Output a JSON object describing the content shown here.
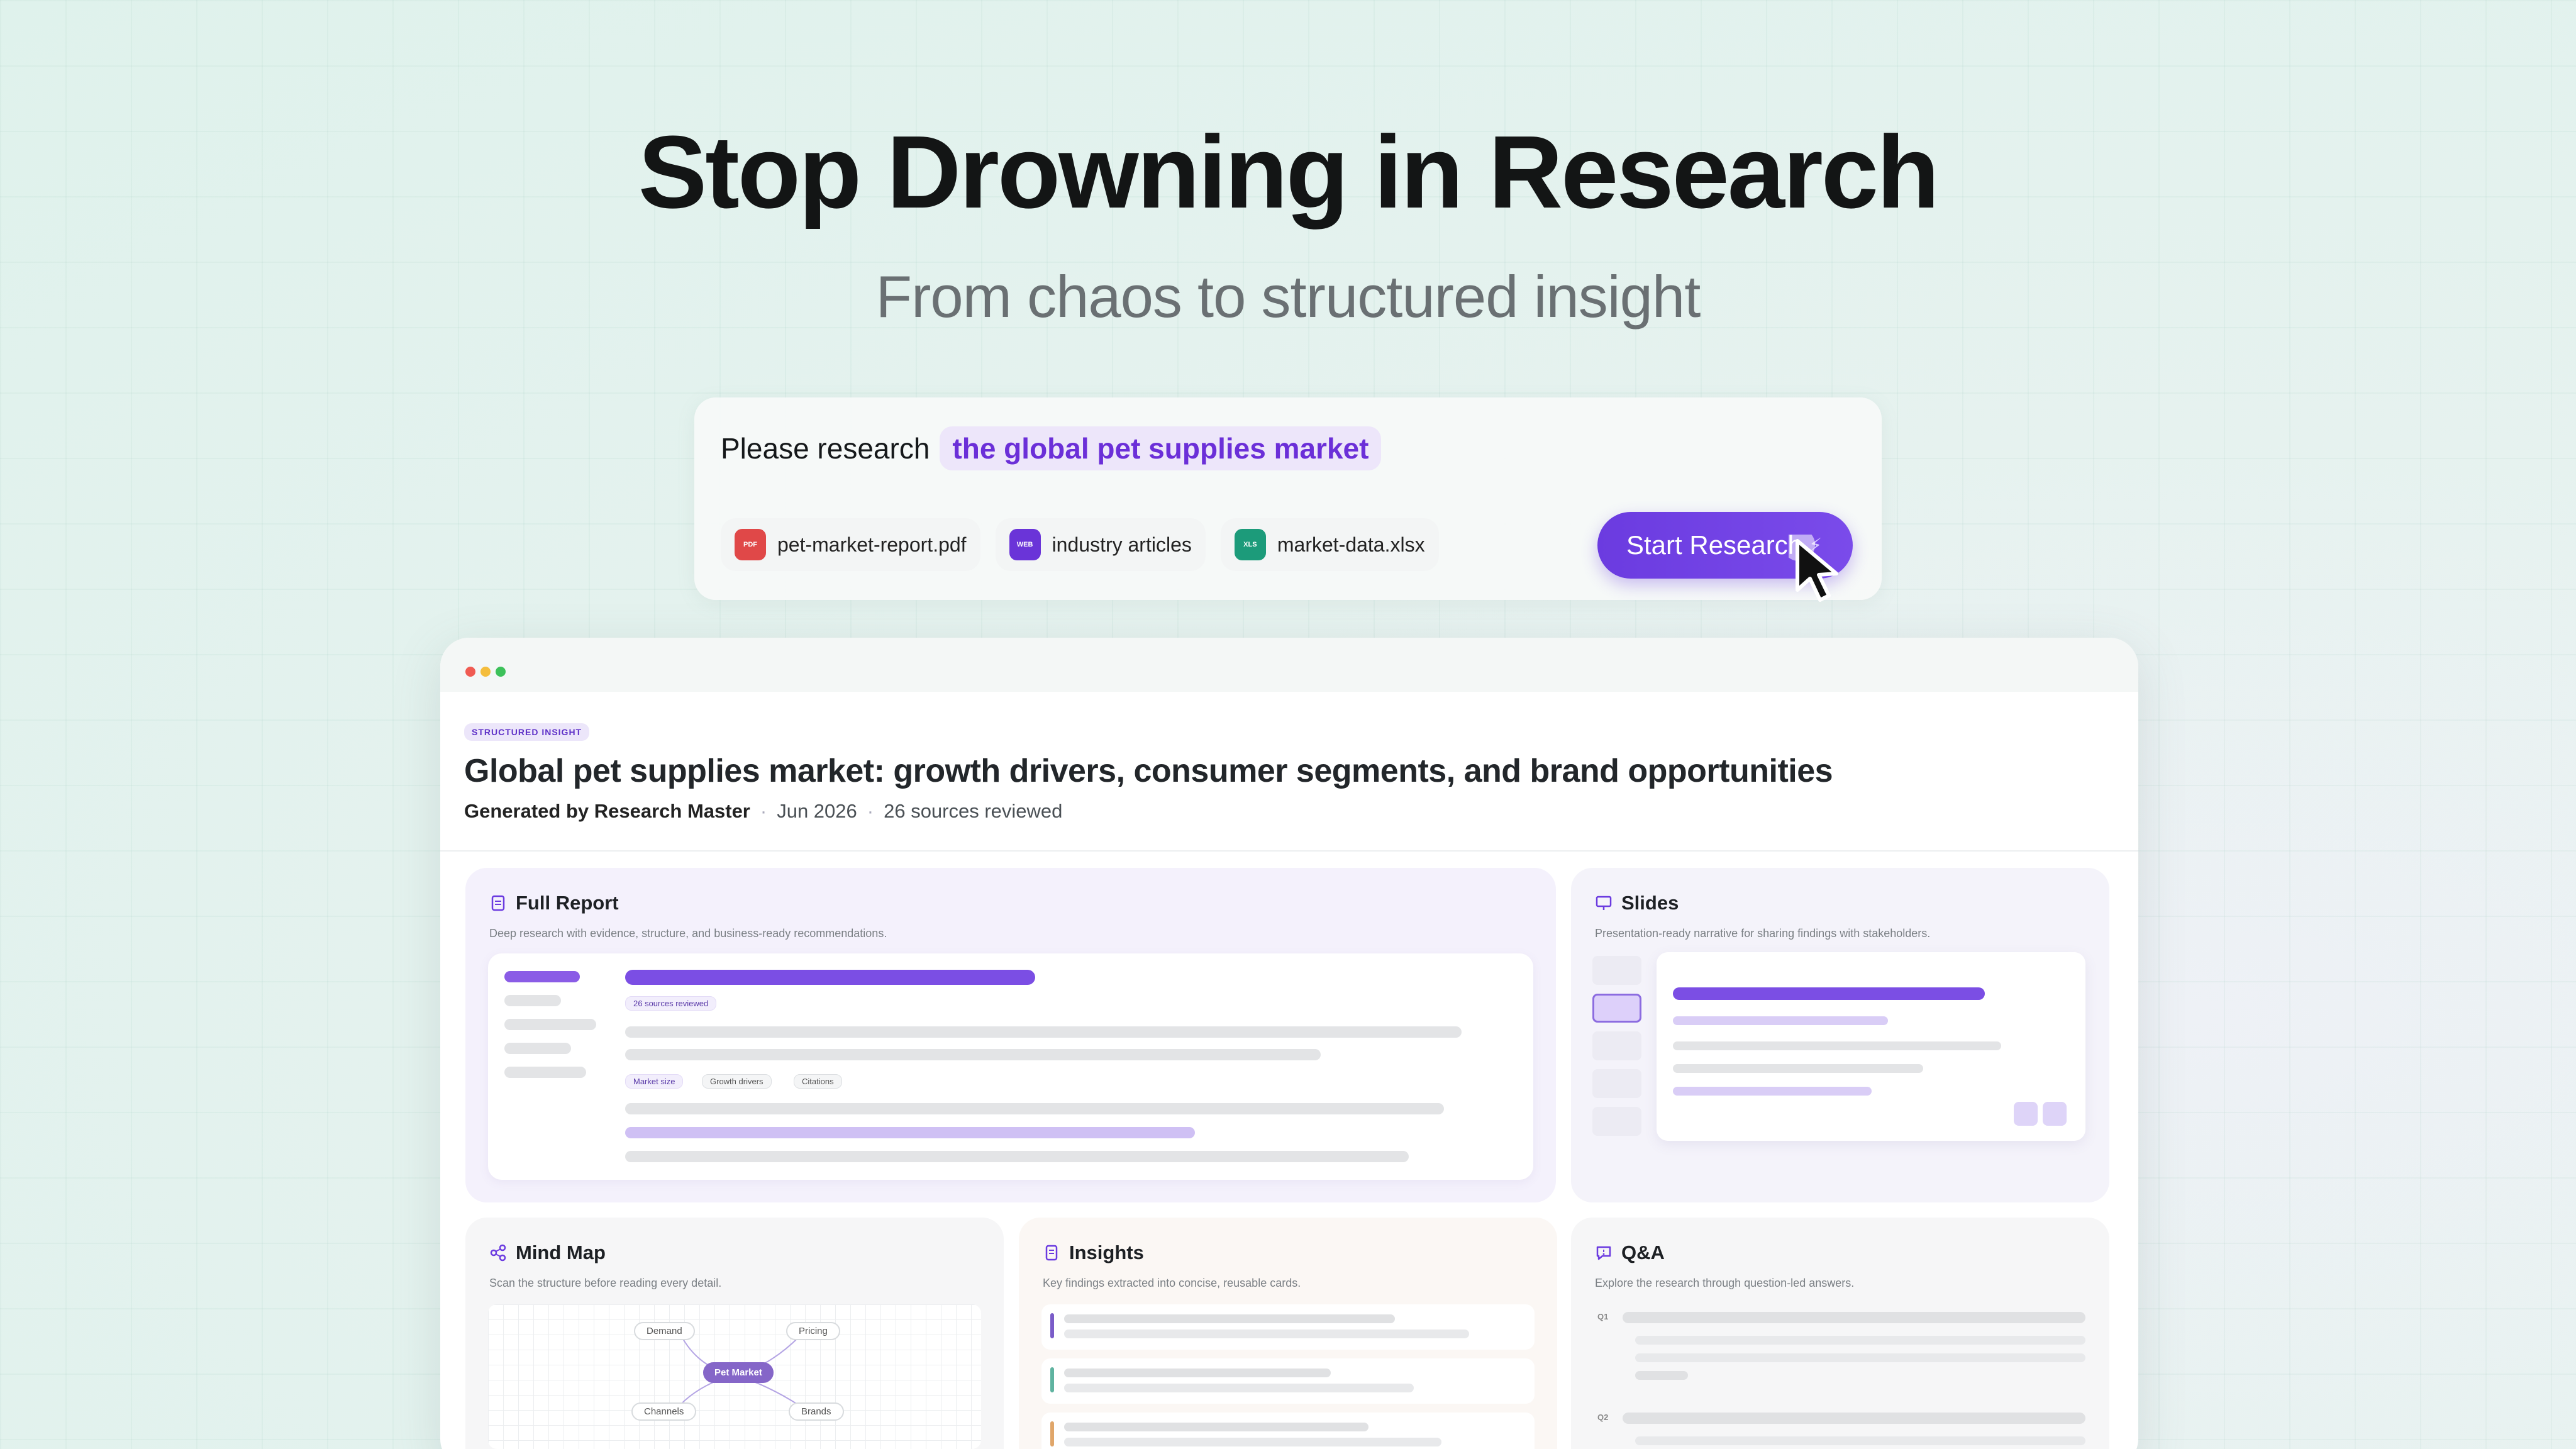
{
  "hero": {
    "title": "Stop Drowning in Research",
    "subtitle": "From chaos to structured insight"
  },
  "prompt": {
    "text": "Please research",
    "topic": "the global pet supplies market",
    "attachments": [
      {
        "badge": "PDF",
        "name": "pet-market-report.pdf",
        "color": "#e04848"
      },
      {
        "badge": "WEB",
        "name": "industry articles",
        "color": "#6a34d8"
      },
      {
        "badge": "XLS",
        "name": "market-data.xlsx",
        "color": "#1c9b7a"
      }
    ],
    "button": "Start Research"
  },
  "document": {
    "tag": "STRUCTURED INSIGHT",
    "title": "Global pet supplies market: growth drivers, consumer segments, and brand opportunities",
    "generated_by": "Generated by Research Master",
    "date": "Jun 2026",
    "sources": "26 sources reviewed"
  },
  "cards": {
    "full_report": {
      "title": "Full Report",
      "desc": "Deep research with evidence, structure, and business-ready recommendations.",
      "sources_tag": "26 sources reviewed",
      "tags": [
        "Market size",
        "Growth drivers",
        "Citations"
      ]
    },
    "slides": {
      "title": "Slides",
      "desc": "Presentation-ready narrative for sharing findings with stakeholders."
    },
    "mind_map": {
      "title": "Mind Map",
      "desc": "Scan the structure before reading every detail.",
      "center": "Pet Market",
      "nodes": [
        "Demand",
        "Pricing",
        "Channels",
        "Brands"
      ]
    },
    "insights": {
      "title": "Insights",
      "desc": "Key findings extracted into concise, reusable cards."
    },
    "qa": {
      "title": "Q&A",
      "desc": "Explore the research through question-led answers.",
      "q1": "Q1",
      "q2": "Q2"
    }
  },
  "colors": {
    "accent": "#6b3be0",
    "accent_light": "#ede6fa",
    "dot_red": "#f05b52",
    "dot_yellow": "#f4bd3c",
    "dot_green": "#3cc15a"
  }
}
